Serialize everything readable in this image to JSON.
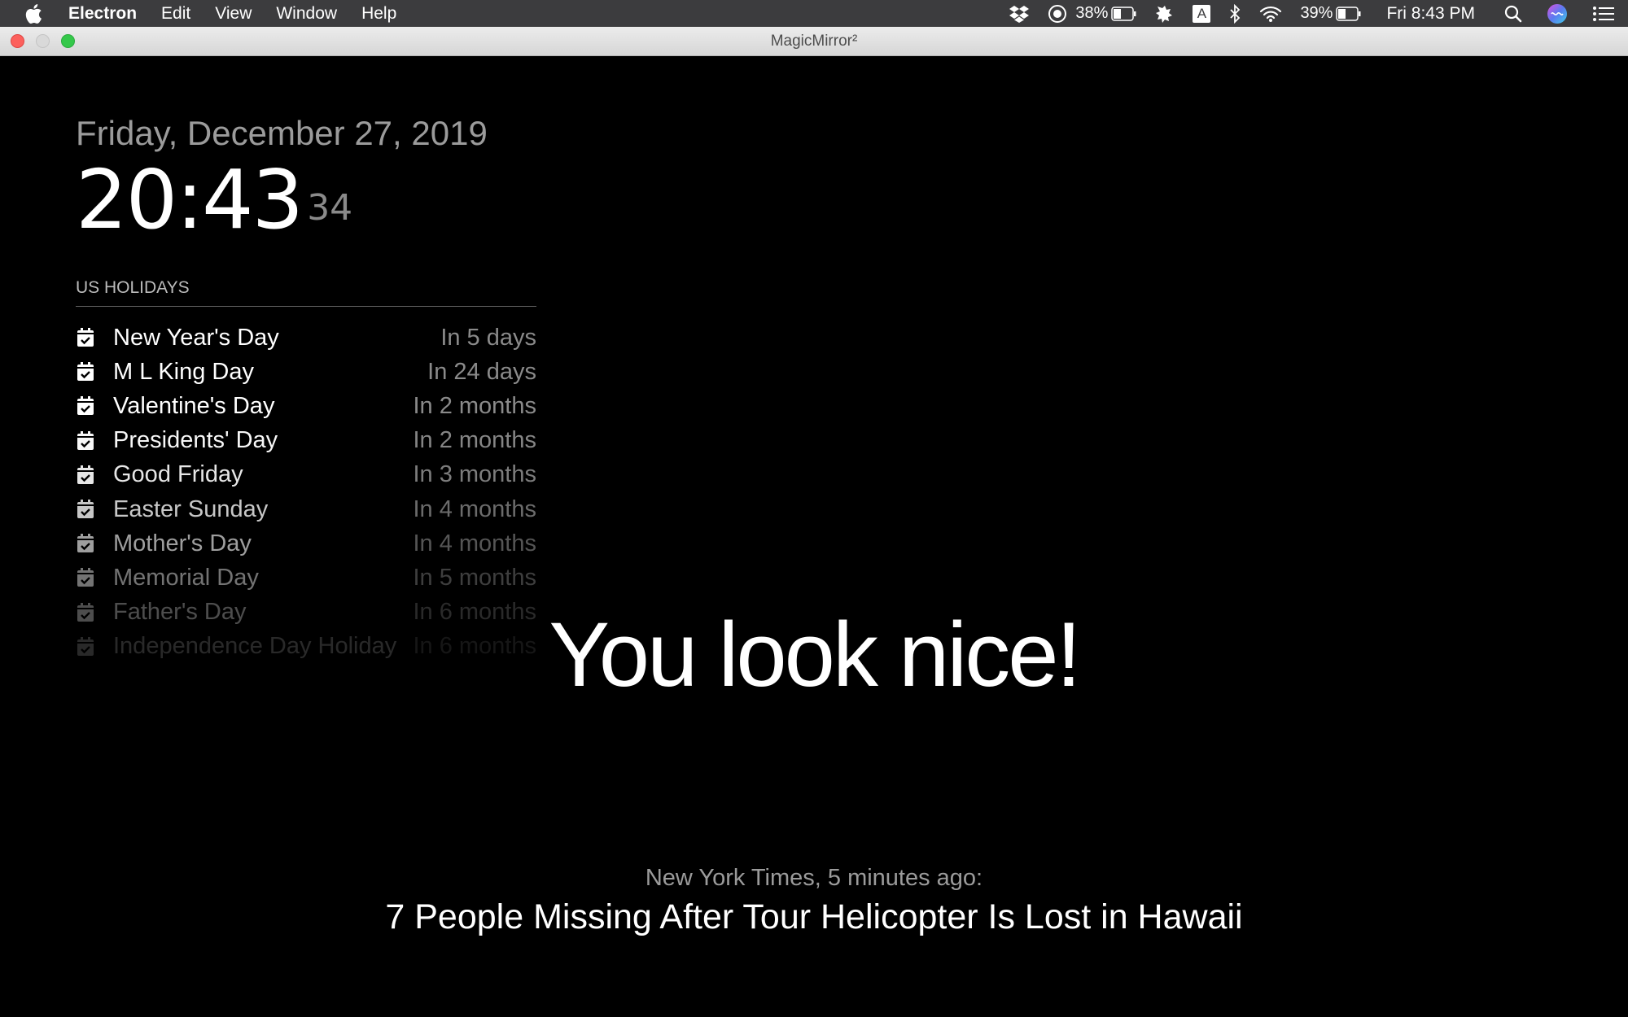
{
  "menubar": {
    "app_name": "Electron",
    "items": [
      "Edit",
      "View",
      "Window",
      "Help"
    ],
    "status": {
      "icons": [
        "dropbox-icon",
        "sync-icon",
        "battery-icon",
        "tool-icon",
        "keyboard-a-icon",
        "bluetooth-icon",
        "wifi-icon",
        "battery-icon",
        "spotlight-search-icon",
        "siri-icon",
        "notification-center-icon"
      ],
      "battery1_text": "38%",
      "input_source": "A",
      "battery2_text": "39%",
      "clock": "Fri 8:43 PM"
    }
  },
  "window": {
    "title": "MagicMirror²"
  },
  "clock": {
    "date": "Friday, December 27, 2019",
    "time": "20:43",
    "seconds": "34"
  },
  "calendar": {
    "header": "US HOLIDAYS",
    "events": [
      {
        "title": "New Year's Day",
        "when": "In 5 days"
      },
      {
        "title": "M L King Day",
        "when": "In 24 days"
      },
      {
        "title": "Valentine's Day",
        "when": "In 2 months"
      },
      {
        "title": "Presidents' Day",
        "when": "In 2 months"
      },
      {
        "title": "Good Friday",
        "when": "In 3 months"
      },
      {
        "title": "Easter Sunday",
        "when": "In 4 months"
      },
      {
        "title": "Mother's Day",
        "when": "In 4 months"
      },
      {
        "title": "Memorial Day",
        "when": "In 5 months"
      },
      {
        "title": "Father's Day",
        "when": "In 6 months"
      },
      {
        "title": "Independence Day Holiday",
        "when": "In 6 months"
      }
    ]
  },
  "compliment": "You look nice!",
  "news": {
    "source": "New York Times, 5 minutes ago:",
    "headline": "7 People Missing After Tour Helicopter Is Lost in Hawaii"
  }
}
